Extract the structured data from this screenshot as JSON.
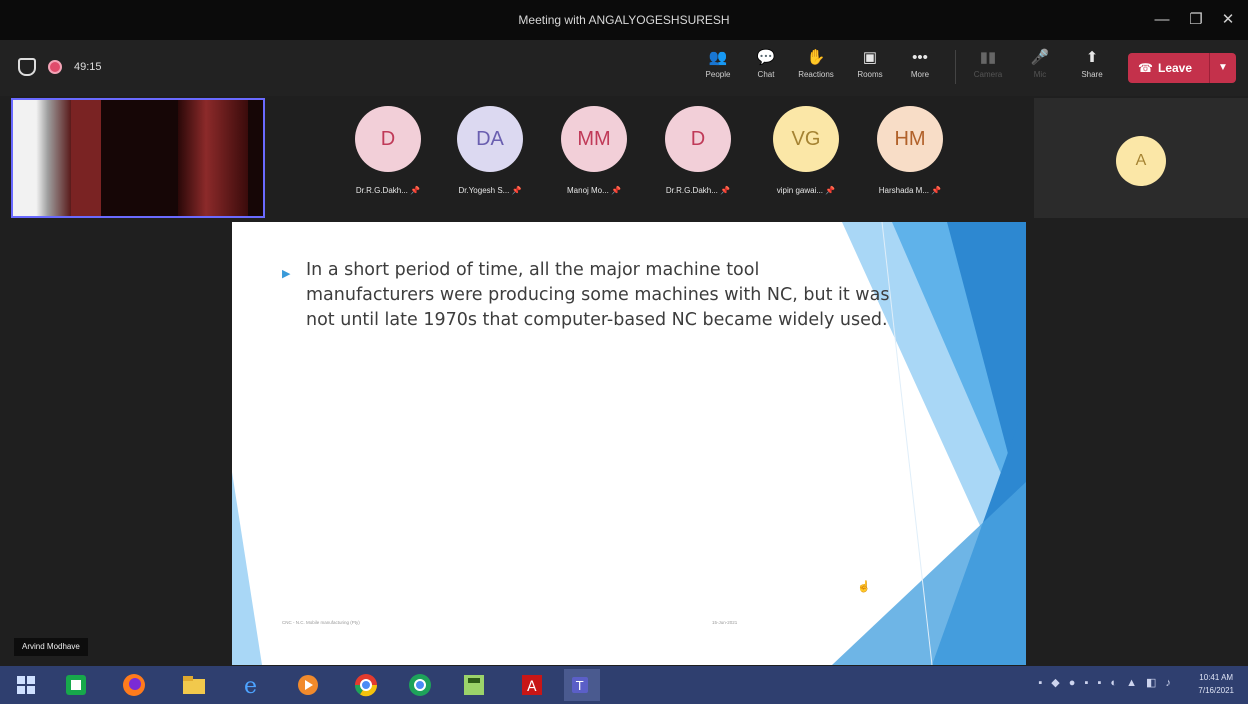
{
  "window": {
    "title": "Meeting with ANGALYOGESHSURESH",
    "controls": {
      "minimize": "—",
      "restore": "❐",
      "close": "✕"
    }
  },
  "toolbar": {
    "timer": "49:15",
    "buttons": [
      {
        "label": "People",
        "icon": "people-icon",
        "glyph": "👥"
      },
      {
        "label": "Chat",
        "icon": "chat-icon",
        "glyph": "💬"
      },
      {
        "label": "Reactions",
        "icon": "reactions-icon",
        "glyph": "✋"
      },
      {
        "label": "Rooms",
        "icon": "rooms-icon",
        "glyph": "▣"
      },
      {
        "label": "More",
        "icon": "more-icon",
        "glyph": "•••"
      },
      {
        "label": "Camera",
        "icon": "camera-icon",
        "glyph": "▮▮"
      },
      {
        "label": "Mic",
        "icon": "mic-icon",
        "glyph": "🎤"
      },
      {
        "label": "Share",
        "icon": "share-icon",
        "glyph": "⬆"
      }
    ],
    "leave_label": "Leave",
    "leave_color": "#c4314b"
  },
  "participants": [
    {
      "initials": "D",
      "name": "Dr.R.G.Dakh...",
      "color": "pink"
    },
    {
      "initials": "DA",
      "name": "Dr.Yogesh S...",
      "color": "lav"
    },
    {
      "initials": "MM",
      "name": "Manoj Mo...",
      "color": "pink"
    },
    {
      "initials": "D",
      "name": "Dr.R.G.Dakh...",
      "color": "pink"
    },
    {
      "initials": "VG",
      "name": "vipin gawai...",
      "color": "yel"
    },
    {
      "initials": "HM",
      "name": "Harshada M...",
      "color": "peach"
    }
  ],
  "overflow_participant": {
    "initials": "A"
  },
  "slide": {
    "bullet": "In a short period of time, all the major machine tool manufacturers were producing some machines with NC, but it was not until late 1970s that computer-based NC became widely used.",
    "footer_left": "CNC - N.C. Mobile manufacturing (Pty)",
    "footer_right": "15-Jun-2021",
    "accent_colors": [
      "#2d88d1",
      "#5fb2ea",
      "#a9d7f6"
    ]
  },
  "presenter_name": "Arvind Modhave",
  "taskbar": {
    "apps": [
      "windows-start-icon",
      "teams-calendar-icon",
      "firefox-icon",
      "file-explorer-icon",
      "internet-explorer-icon",
      "media-player-icon",
      "chrome-icon",
      "chrome-alt-icon",
      "calculator-icon",
      "acrobat-icon",
      "teams-icon"
    ],
    "clock_time": "10:41 AM",
    "clock_date": "7/16/2021"
  }
}
